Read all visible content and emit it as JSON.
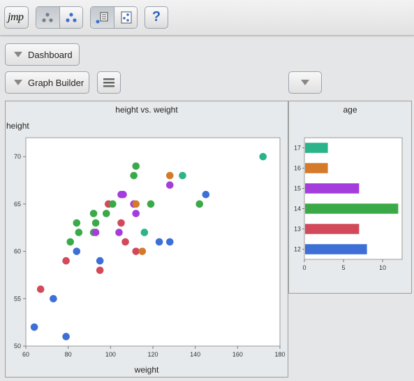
{
  "toolbar": {
    "logo_text": "jmp",
    "help_label": "?",
    "buttons": [
      "points-icon",
      "points-color-icon",
      "local-data-filter-icon",
      "column-switcher-icon",
      "help-icon"
    ]
  },
  "dashboard": {
    "label": "Dashboard"
  },
  "graph_builder": {
    "label": "Graph Builder"
  },
  "scatter": {
    "title": "height vs. weight",
    "xlabel": "weight",
    "ylabel": "height"
  },
  "bar": {
    "title": "age"
  },
  "colors": {
    "12": "#3d6fd6",
    "13": "#d24a5a",
    "14": "#3aaa48",
    "15": "#a43ddc",
    "16": "#d47a2a",
    "17": "#2bb38a"
  },
  "chart_data": [
    {
      "type": "scatter",
      "title": "height vs. weight",
      "xlabel": "weight",
      "ylabel": "height",
      "xlim": [
        60,
        180
      ],
      "ylim": [
        50,
        72
      ],
      "xticks": [
        60,
        80,
        100,
        120,
        140,
        160,
        180
      ],
      "yticks": [
        50,
        55,
        60,
        65,
        70
      ],
      "grid": false,
      "series": [
        {
          "name": "12",
          "points": [
            [
              64,
              52
            ],
            [
              73,
              55
            ],
            [
              79,
              51
            ],
            [
              84,
              60
            ],
            [
              95,
              59
            ],
            [
              123,
              61
            ],
            [
              128,
              61
            ],
            [
              145,
              66
            ]
          ]
        },
        {
          "name": "13",
          "points": [
            [
              67,
              56
            ],
            [
              79,
              59
            ],
            [
              95,
              58
            ],
            [
              99,
              65
            ],
            [
              105,
              63
            ],
            [
              107,
              61
            ],
            [
              112,
              60
            ]
          ]
        },
        {
          "name": "14",
          "points": [
            [
              81,
              61
            ],
            [
              84,
              63
            ],
            [
              85,
              62
            ],
            [
              92,
              64
            ],
            [
              93,
              63
            ],
            [
              98,
              64
            ],
            [
              101,
              65
            ],
            [
              111,
              68
            ],
            [
              112,
              69
            ],
            [
              119,
              65
            ],
            [
              142,
              65
            ],
            [
              92,
              62
            ]
          ]
        },
        {
          "name": "15",
          "points": [
            [
              93,
              62
            ],
            [
              104,
              62
            ],
            [
              105,
              66
            ],
            [
              106,
              66
            ],
            [
              111,
              65
            ],
            [
              112,
              64
            ],
            [
              128,
              67
            ]
          ]
        },
        {
          "name": "16",
          "points": [
            [
              112,
              65
            ],
            [
              115,
              60
            ],
            [
              128,
              68
            ]
          ]
        },
        {
          "name": "17",
          "points": [
            [
              116,
              62
            ],
            [
              134,
              68
            ],
            [
              172,
              70
            ]
          ]
        }
      ]
    },
    {
      "type": "bar",
      "orientation": "horizontal",
      "title": "age",
      "categories": [
        "12",
        "13",
        "14",
        "15",
        "16",
        "17"
      ],
      "values": [
        8,
        7,
        12,
        7,
        3,
        3
      ],
      "xlim": [
        0,
        12.5
      ],
      "xticks": [
        0,
        5,
        10
      ]
    }
  ]
}
